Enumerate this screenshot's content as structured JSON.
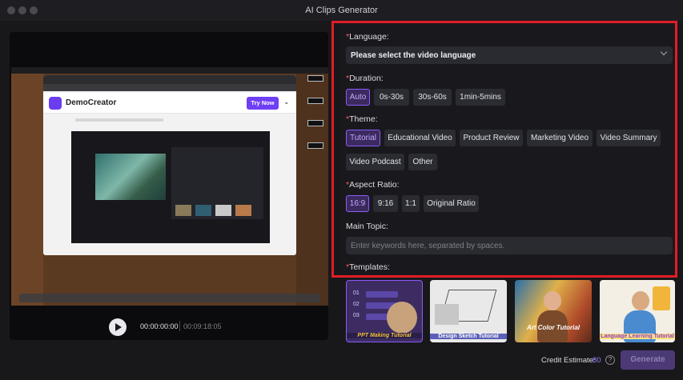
{
  "window": {
    "title": "AI Clips Generator"
  },
  "preview": {
    "brand": "DemoCreator",
    "try_label": "Try Now"
  },
  "player": {
    "current_time": "00:00:00:00",
    "total_time": "00:09:18:05"
  },
  "settings": {
    "required_mark": "*",
    "language": {
      "label": "Language:",
      "value": "Please select the video language"
    },
    "duration": {
      "label": "Duration:",
      "options": [
        "Auto",
        "0s-30s",
        "30s-60s",
        "1min-5mins"
      ],
      "selected": "Auto"
    },
    "theme": {
      "label": "Theme:",
      "options": [
        "Tutorial",
        "Educational Video",
        "Product Review",
        "Marketing Video",
        "Video Summary",
        "Video Podcast",
        "Other"
      ],
      "selected": "Tutorial"
    },
    "aspect_ratio": {
      "label": "Aspect Ratio:",
      "options": [
        "16:9",
        "9:16",
        "1:1",
        "Original Ratio"
      ],
      "selected": "16:9"
    },
    "main_topic": {
      "label": "Main Topic:",
      "placeholder": "Enter keywords here, separated by spaces."
    },
    "templates": {
      "label": "Templates:",
      "items": [
        {
          "caption": "PPT Making Tutorial",
          "rows": [
            "01",
            "02",
            "03"
          ]
        },
        {
          "caption": "Design Sketch Tutorial"
        },
        {
          "caption": "Art Color Tutorial"
        },
        {
          "caption": "Language Learning Tutorial"
        }
      ]
    }
  },
  "footer": {
    "credit_label": "Credit Estimate:",
    "credit_value": "80",
    "help_glyph": "?",
    "generate_label": "Generate"
  },
  "colors": {
    "accent": "#8b5cf6",
    "highlight_frame": "#e01e25",
    "background": "#18181b"
  }
}
